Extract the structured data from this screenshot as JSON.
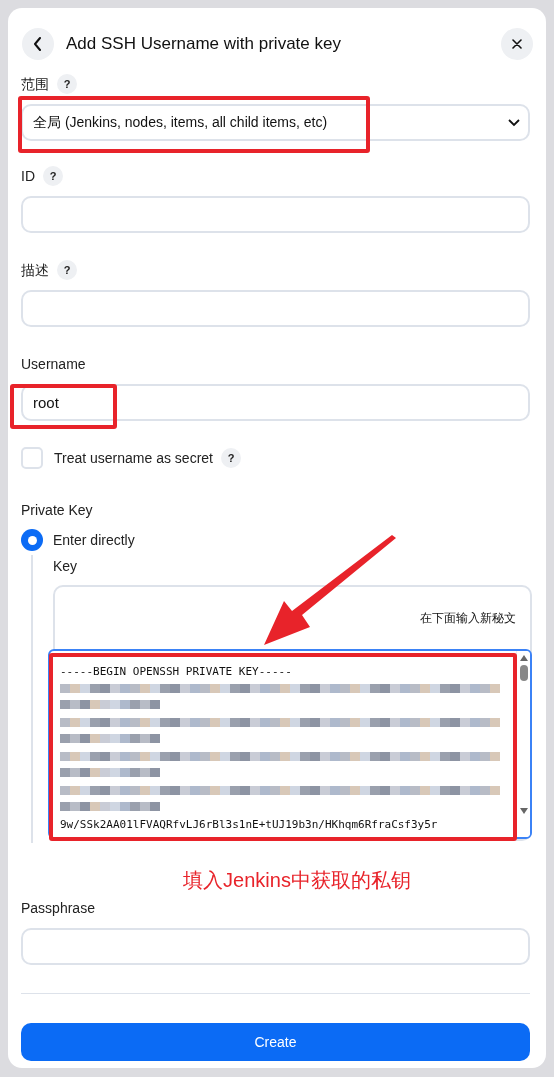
{
  "dialog": {
    "title": "Add SSH Username with private key"
  },
  "scope": {
    "label": "范围",
    "help": "?",
    "value": "全局 (Jenkins, nodes, items, all child items, etc)"
  },
  "id_field": {
    "label": "ID",
    "help": "?"
  },
  "description_field": {
    "label": "描述",
    "help": "?"
  },
  "username_field": {
    "label": "Username",
    "value": "root"
  },
  "treat_secret": {
    "label": "Treat username as secret",
    "help": "?",
    "checked": false
  },
  "private_key": {
    "label": "Private Key",
    "options": [
      {
        "label": "Enter directly",
        "selected": true
      }
    ],
    "key_label": "Key",
    "hint": "在下面输入新秘文",
    "lines": [
      {
        "kind": "text",
        "text": "-----BEGIN OPENSSH PRIVATE KEY-----"
      },
      {
        "kind": "redacted"
      },
      {
        "kind": "redacted"
      },
      {
        "kind": "redacted"
      },
      {
        "kind": "redacted"
      },
      {
        "kind": "text",
        "text": "9w/SSk2AA01lFVAQRfvLJ6rBl3s1nE+tUJ19b3n/HKhqm6RfraCsf3y5r"
      }
    ]
  },
  "annotation": {
    "caption": "填入Jenkins中获取的私钥"
  },
  "passphrase_field": {
    "label": "Passphrase"
  },
  "buttons": [
    "Create"
  ]
}
